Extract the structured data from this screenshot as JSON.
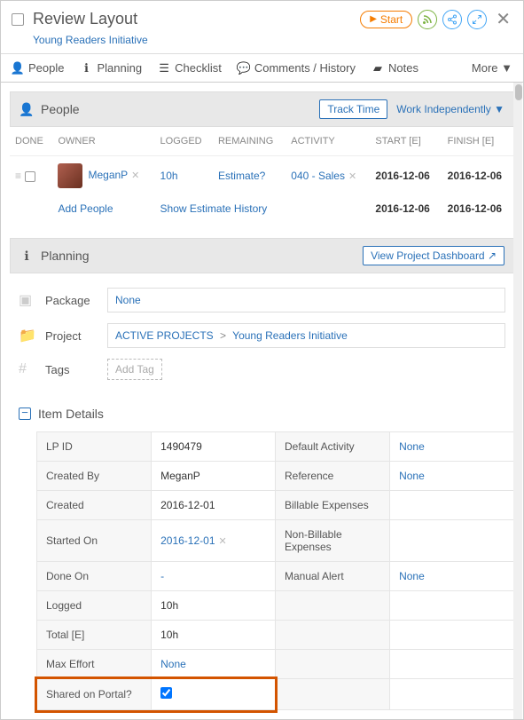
{
  "header": {
    "title": "Review Layout",
    "subtitle": "Young Readers Initiative",
    "start_btn": "Start"
  },
  "tabs": {
    "people": "People",
    "planning": "Planning",
    "checklist": "Checklist",
    "comments": "Comments / History",
    "notes": "Notes",
    "more": "More ▼"
  },
  "people_section": {
    "title": "People",
    "track_time": "Track Time",
    "work_ind": "Work Independently ▼",
    "cols": {
      "done": "DONE",
      "owner": "OWNER",
      "logged": "LOGGED",
      "remaining": "REMAINING",
      "activity": "ACTIVITY",
      "start": "START [E]",
      "finish": "FINISH [E]"
    },
    "row1": {
      "owner": "MeganP",
      "logged": "10h",
      "remaining": "Estimate?",
      "activity": "040 - Sales",
      "start": "2016-12-06",
      "finish": "2016-12-06"
    },
    "row2": {
      "add_people": "Add People",
      "show_history": "Show Estimate History",
      "start": "2016-12-06",
      "finish": "2016-12-06"
    }
  },
  "planning_section": {
    "title": "Planning",
    "view_dash": "View Project Dashboard ↗",
    "package_lbl": "Package",
    "package_val": "None",
    "project_lbl": "Project",
    "project_root": "ACTIVE PROJECTS",
    "project_leaf": "Young Readers Initiative",
    "tags_lbl": "Tags",
    "tags_placeholder": "Add Tag"
  },
  "item_details": {
    "title": "Item Details",
    "rows": [
      {
        "l1": "LP ID",
        "v1": "1490479",
        "l2": "Default Activity",
        "v2": "None",
        "v1link": false,
        "v2link": true
      },
      {
        "l1": "Created By",
        "v1": "MeganP",
        "l2": "Reference",
        "v2": "None",
        "v1link": false,
        "v2link": true
      },
      {
        "l1": "Created",
        "v1": "2016-12-01",
        "l2": "Billable Expenses",
        "v2": "",
        "v1link": false,
        "v2link": false
      },
      {
        "l1": "Started On",
        "v1": "2016-12-01",
        "l2": "Non-Billable Expenses",
        "v2": "",
        "v1link": true,
        "v2link": false,
        "v1rm": true
      },
      {
        "l1": "Done On",
        "v1": "-",
        "l2": "Manual Alert",
        "v2": "None",
        "v1link": true,
        "v2link": true
      },
      {
        "l1": "Logged",
        "v1": "10h",
        "l2": "",
        "v2": "",
        "v1link": false,
        "v2link": false
      },
      {
        "l1": "Total [E]",
        "v1": "10h",
        "l2": "",
        "v2": "",
        "v1link": false,
        "v2link": false
      },
      {
        "l1": "Max Effort",
        "v1": "None",
        "l2": "",
        "v2": "",
        "v1link": true,
        "v2link": false
      },
      {
        "l1": "Shared on Portal?",
        "v1": "",
        "l2": "",
        "v2": "",
        "v1link": false,
        "v2link": false,
        "chk": true,
        "highlight": true
      }
    ]
  }
}
